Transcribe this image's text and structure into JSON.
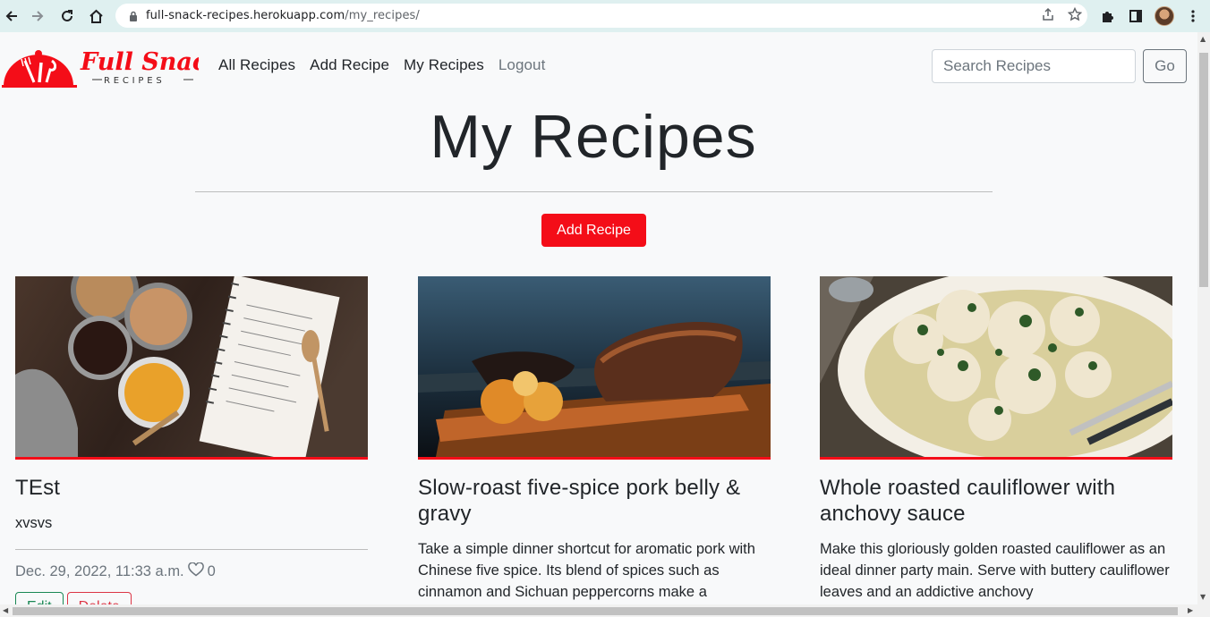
{
  "browser": {
    "url_host": "full-snack-recipes.herokuapp.com",
    "url_path": "/my_recipes/"
  },
  "brand": {
    "name": "Full Snack",
    "tagline": "RECIPES"
  },
  "nav": {
    "links": [
      {
        "label": "All Recipes"
      },
      {
        "label": "Add Recipe"
      },
      {
        "label": "My Recipes"
      },
      {
        "label": "Logout"
      }
    ],
    "search_placeholder": "Search Recipes",
    "go_label": "Go"
  },
  "page": {
    "title": "My Recipes",
    "add_button": "Add Recipe"
  },
  "cards": [
    {
      "title": "TEst",
      "description": "xvsvs",
      "date": "Dec. 29, 2022, 11:33 a.m.",
      "likes": "0",
      "edit_label": "Edit",
      "delete_label": "Delete"
    },
    {
      "title": "Slow-roast five-spice pork belly & gravy",
      "description": "Take a simple dinner shortcut for aromatic pork with Chinese five spice. Its blend of spices such as cinnamon and Sichuan peppercorns make a"
    },
    {
      "title": "Whole roasted cauliflower with anchovy sauce",
      "description": "Make this gloriously golden roasted cauliflower as an ideal dinner party main. Serve with buttery cauliflower leaves and an addictive anchovy"
    }
  ],
  "colors": {
    "brand_red": "#f40d18",
    "edit_green": "#198754",
    "delete_red": "#dc3545"
  }
}
